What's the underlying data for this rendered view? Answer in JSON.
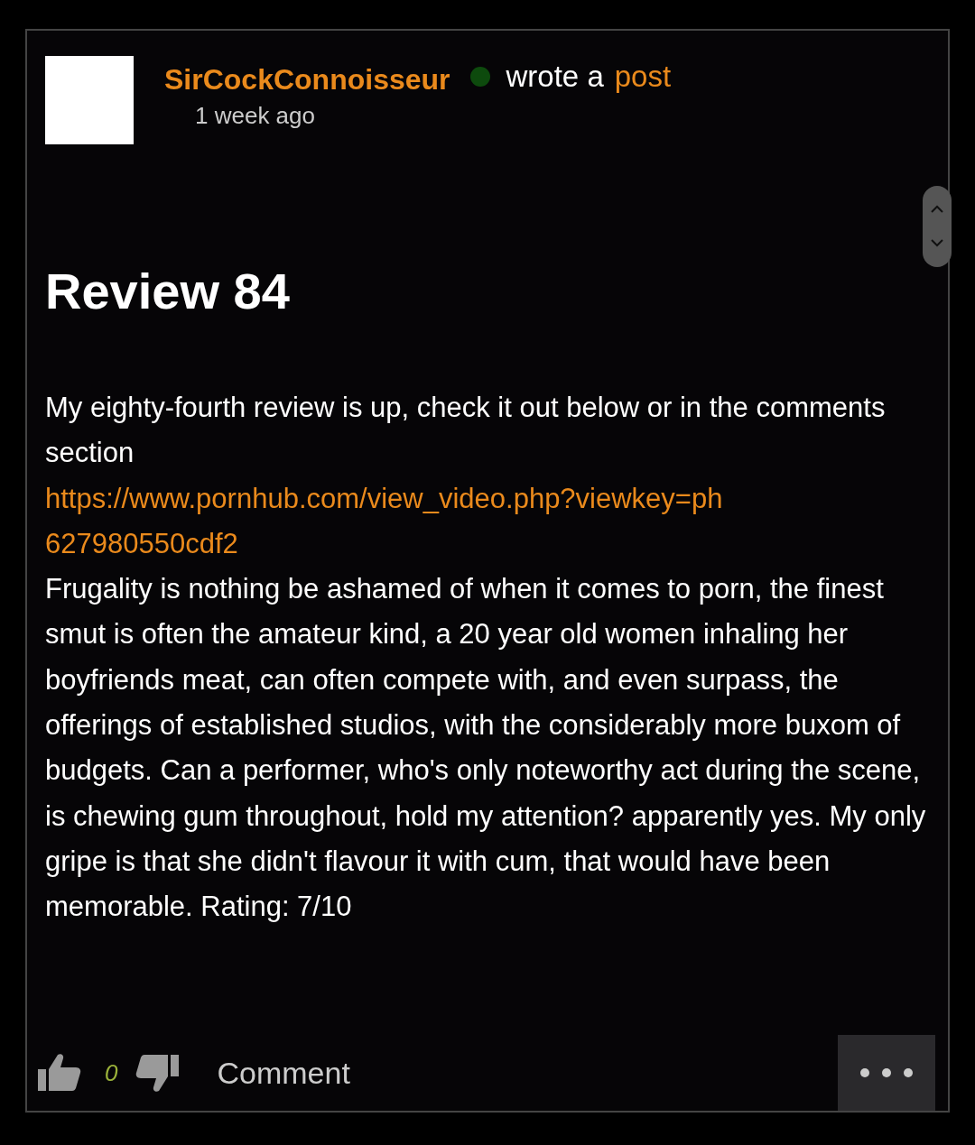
{
  "post": {
    "author": "SirCockConnoisseur",
    "online": true,
    "action": "wrote a",
    "action_link": "post",
    "time": "1 week ago",
    "title": "Review 84",
    "intro": "My eighty-fourth review is up, check it out below or in the comments section",
    "link": "https://www.pornhub.com/view_video.php?viewkey=ph627980550cdf2",
    "text": "Frugality is nothing be ashamed of when it comes to porn, the finest smut is often the amateur kind, a 20 year old women inhaling her boyfriends meat, can often compete with, and even surpass, the offerings of established studios, with the considerably more buxom of budgets. Can a performer, who's only noteworthy act during the scene, is chewing gum throughout, hold my attention? apparently yes. My only gripe is that she didn't flavour it with cum, that would have been memorable. Rating: 7/10",
    "likes": "0",
    "comment": "Comment"
  }
}
